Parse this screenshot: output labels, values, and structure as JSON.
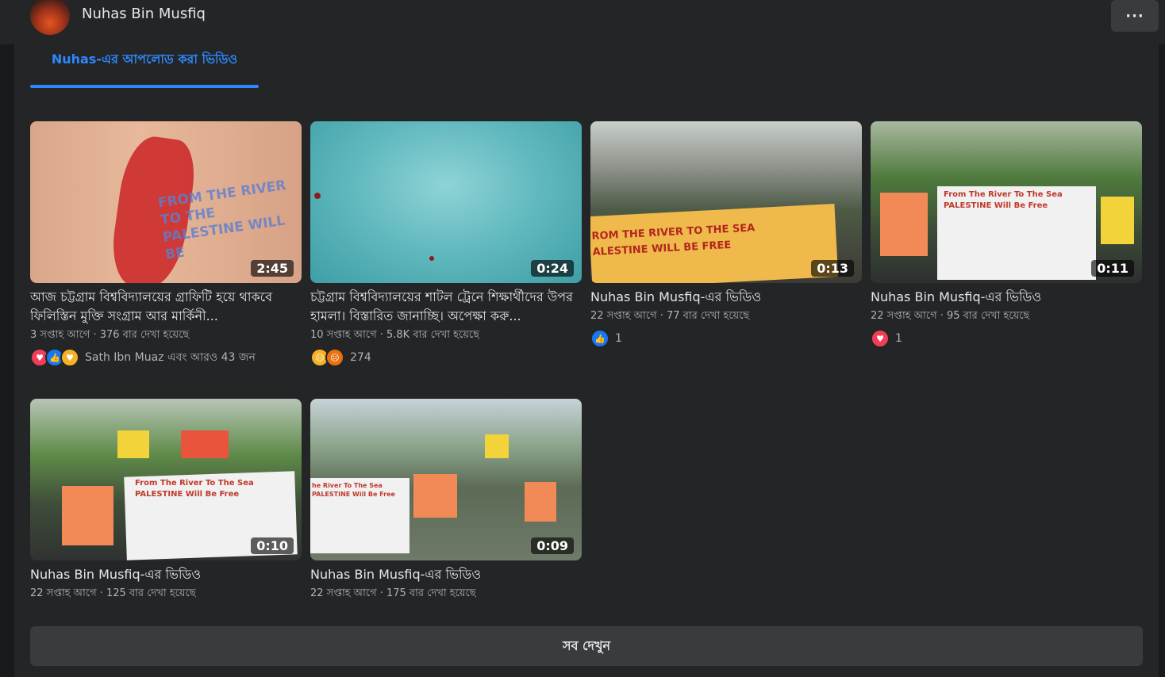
{
  "header": {
    "profile_name": "Nuhas Bin Musfiq",
    "more_label": "···"
  },
  "tab": {
    "label": "Nuhas-এর আপলোড করা ভিডিও"
  },
  "videos": [
    {
      "duration": "2:45",
      "title": "আজ চট্টগ্রাম বিশ্ববিদ্যালয়ের গ্রাফিটি হয়ে থাকবে ফিলিস্তিন মুক্তি সংগ্রাম আর মার্কিনী...",
      "meta": "3 সপ্তাহ আগে · 376 বার দেখা হয়েছে",
      "reactions": [
        "heart-icon",
        "like-icon",
        "care-icon"
      ],
      "reaction_text": "Sath Ibn Muaz এবং আরও 43 জন",
      "thumb_text": "FROM THE RIVER TO THE PALESTINE WILL BE"
    },
    {
      "duration": "0:24",
      "title": "চট্টগ্রাম বিশ্ববিদ্যালয়ের শাটল ট্রেনে শিক্ষার্থীদের উপর হামলা। বিস্তারিত জানাচ্ছি। অপেক্ষা করু...",
      "meta": "10 সপ্তাহ আগে · 5.8K বার দেখা হয়েছে",
      "reactions": [
        "sad-icon",
        "angry-icon"
      ],
      "reaction_text": "274"
    },
    {
      "duration": "0:13",
      "title": "Nuhas Bin Musfiq-এর ভিডিও",
      "meta": "22 সপ্তাহ আগে · 77 বার দেখা হয়েছে",
      "reactions": [
        "like-icon"
      ],
      "reaction_text": "1",
      "thumb_text": "ROM THE RIVER TO THE SEA ALESTINE WILL BE FREE"
    },
    {
      "duration": "0:11",
      "title": "Nuhas Bin Musfiq-এর ভিডিও",
      "meta": "22 সপ্তাহ আগে · 95 বার দেখা হয়েছে",
      "reactions": [
        "heart-icon"
      ],
      "reaction_text": "1",
      "thumb_text": "From The River To The Sea PALESTINE Will Be Free"
    },
    {
      "duration": "0:10",
      "title": "Nuhas Bin Musfiq-এর ভিডিও",
      "meta": "22 সপ্তাহ আগে · 125 বার দেখা হয়েছে",
      "thumb_text": "From The River To The Sea PALESTINE Will Be Free"
    },
    {
      "duration": "0:09",
      "title": "Nuhas Bin Musfiq-এর ভিডিও",
      "meta": "22 সপ্তাহ আগে · 175 বার দেখা হয়েছে",
      "thumb_text": "he River To The Sea PALESTINE Will Be Free"
    }
  ],
  "see_all_label": "সব দেখুন",
  "colors": {
    "accent": "#2d88ff",
    "panel": "#242526",
    "bg": "#18191a"
  }
}
